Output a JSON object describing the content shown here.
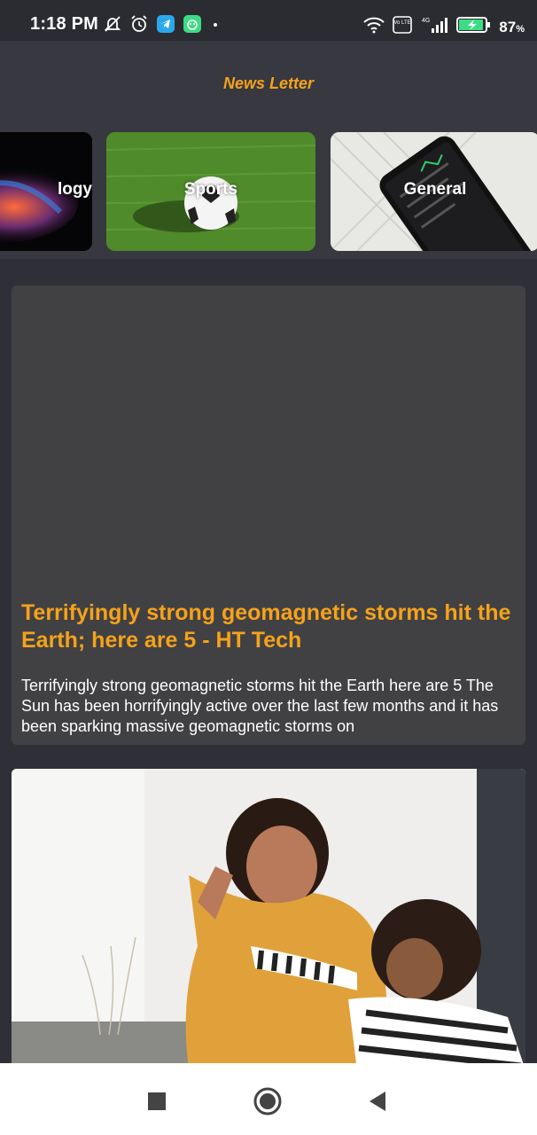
{
  "status_bar": {
    "time": "1:18 PM",
    "battery_percent": "87",
    "battery_suffix": "%",
    "network": "4G",
    "volte": "Vo LTE",
    "icons": [
      "muted-bell-icon",
      "alarm-icon",
      "telegram-icon",
      "android-app-icon",
      "dot-icon",
      "wifi-icon",
      "volte-icon",
      "signal-icon",
      "battery-charging-icon"
    ]
  },
  "app": {
    "title": "News Letter",
    "accent_color": "#f6a21a",
    "background_color": "#373840"
  },
  "categories": [
    {
      "label": "logy",
      "image": "technology-photo"
    },
    {
      "label": "Sports",
      "image": "soccer-ball-photo"
    },
    {
      "label": "General",
      "image": "smartphone-photo"
    }
  ],
  "articles": [
    {
      "title": "Terrifyingly strong geomagnetic storms hit the Earth; here are 5 - HT Tech",
      "description": "Terrifyingly strong geomagnetic storms hit the Earth here are 5 The Sun has been horrifyingly active over the last few months and it has been sparking massive geomagnetic storms on"
    },
    {
      "image": "mother-child-high-five-photo"
    }
  ],
  "navigation": {
    "buttons": [
      "recents-square-icon",
      "home-circle-icon",
      "back-triangle-icon"
    ]
  }
}
